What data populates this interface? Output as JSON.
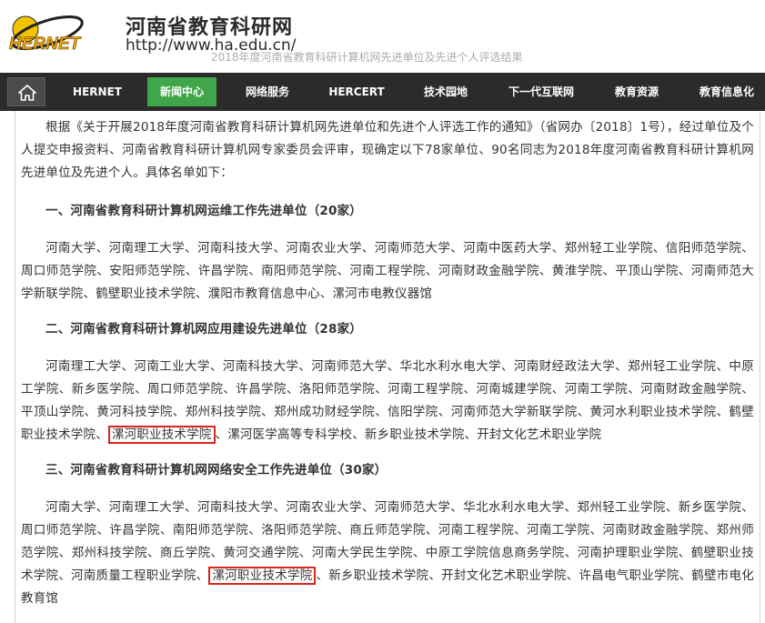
{
  "header": {
    "logo_text": "HERNET",
    "site_title": "河南省教育科研网",
    "site_url": "http://www.ha.edu.cn/",
    "page_title": "2018年度河南省教育科研计算机网先进单位及先进个人评选结果",
    "colors": {
      "accent_green": "#3fa74a",
      "nav_bg": "#2b2b2b",
      "highlight_red": "#d9251c"
    }
  },
  "nav": {
    "home_icon": "home-icon",
    "items": [
      {
        "label": "HERNET"
      },
      {
        "label": "新闻中心",
        "active": true
      },
      {
        "label": "网络服务"
      },
      {
        "label": "HERCERT"
      },
      {
        "label": "技术园地"
      },
      {
        "label": "下一代互联网"
      },
      {
        "label": "教育资源"
      },
      {
        "label": "教育信息化"
      }
    ]
  },
  "article": {
    "intro": "根据《关于开展2018年度河南省教育科研计算机网先进单位和先进个人评选工作的通知》（省网办〔2018〕1号），经过单位及个人提交申报资料、河南省教育科研计算机网专家委员会评审，现确定以下78家单位、90名同志为2018年度河南省教育科研计算机网先进单位及先进个人。具体名单如下：",
    "sections": [
      {
        "title": "一、河南省教育科研计算机网运维工作先进单位（20家）",
        "text_before": "河南大学、河南理工大学、河南科技大学、河南农业大学、河南师范大学、河南中医药大学、郑州轻工业学院、信阳师范学院、周口师范学院、安阳师范学院、许昌学院、南阳师范学院、河南工程学院、河南财政金融学院、黄淮学院、平顶山学院、河南师范大学新联学院、鹤壁职业技术学院、濮阳市教育信息中心、漯河市电教仪器馆"
      },
      {
        "title": "二、河南省教育科研计算机网应用建设先进单位（28家）",
        "text_before": "河南理工大学、河南工业大学、河南科技大学、河南师范大学、华北水利水电大学、河南财经政法大学、郑州轻工业学院、中原工学院、新乡医学院、周口师范学院、许昌学院、洛阳师范学院、河南工程学院、河南城建学院、河南工学院、河南财政金融学院、平顶山学院、黄河科技学院、郑州科技学院、郑州成功财经学院、信阳学院、河南师范大学新联学院、黄河水利职业技术学院、鹤壁职业技术学院、",
        "highlight": "漯河职业技术学院",
        "text_after": "、漯河医学高等专科学校、新乡职业技术学院、开封文化艺术职业学院"
      },
      {
        "title": "三、河南省教育科研计算机网网络安全工作先进单位（30家）",
        "text_before": "河南大学、河南理工大学、河南科技大学、河南农业大学、河南师范大学、华北水利水电大学、郑州轻工业学院、新乡医学院、周口师范学院、许昌学院、南阳师范学院、洛阳师范学院、商丘师范学院、河南工程学院、河南工学院、河南财政金融学院、郑州师范学院、郑州科技学院、商丘学院、黄河交通学院、河南大学民生学院、中原工学院信息商务学院、河南护理职业学院、鹤壁职业技术学院、河南质量工程职业学院、",
        "highlight": "漯河职业技术学院",
        "text_after": "、新乡职业技术学院、开封文化艺术职业学院、许昌电气职业学院、鹤壁市电化教育馆"
      }
    ]
  }
}
